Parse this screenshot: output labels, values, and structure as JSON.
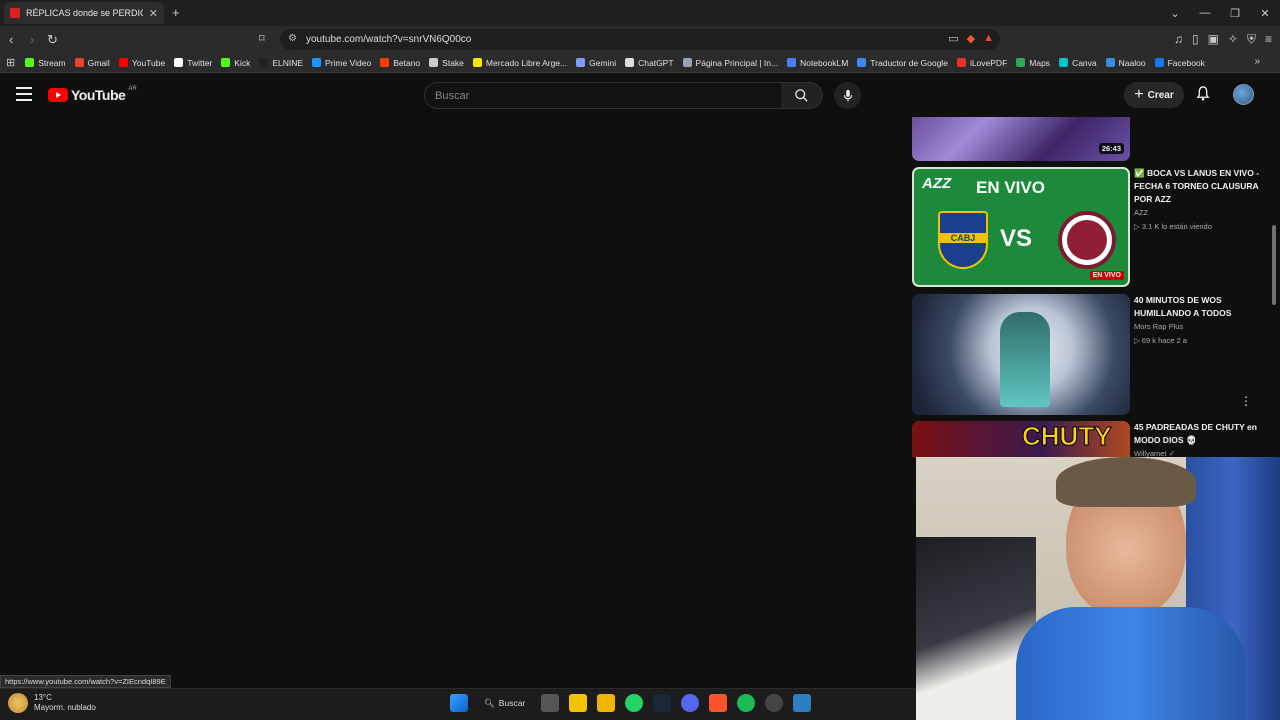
{
  "browser": {
    "tab_title": "RÉPLICAS donde se PERDIÓ TODO",
    "tab_close": "✕",
    "new_tab": "+",
    "url": "youtube.com/watch?v=snrVN6Q00co",
    "window_controls": [
      "⌄",
      "—",
      "❐",
      "✕"
    ],
    "bookmarks": [
      {
        "label": "Stream",
        "color": "#53fc18"
      },
      {
        "label": "Gmail",
        "color": "#ea4335"
      },
      {
        "label": "YouTube",
        "color": "#ff0000"
      },
      {
        "label": "Twitter",
        "color": "#ffffff"
      },
      {
        "label": "Kick",
        "color": "#53fc18"
      },
      {
        "label": "ELNINE",
        "color": "#222222"
      },
      {
        "label": "Prime Video",
        "color": "#1a98ff"
      },
      {
        "label": "Betano",
        "color": "#ff3c00"
      },
      {
        "label": "Stake",
        "color": "#cccccc"
      },
      {
        "label": "Mercado Libre Arge...",
        "color": "#ffe600"
      },
      {
        "label": "Gemini",
        "color": "#7a9cff"
      },
      {
        "label": "ChatGPT",
        "color": "#dddddd"
      },
      {
        "label": "Página Principal | In...",
        "color": "#9aa3b5"
      },
      {
        "label": "NotebookLM",
        "color": "#4b7bff"
      },
      {
        "label": "Traductor de Google",
        "color": "#4285f4"
      },
      {
        "label": "iLovePDF",
        "color": "#e5322d"
      },
      {
        "label": "Maps",
        "color": "#34a853"
      },
      {
        "label": "Canva",
        "color": "#00c4cc"
      },
      {
        "label": "Naaloo",
        "color": "#3a8dde"
      },
      {
        "label": "Facebook",
        "color": "#1877f2"
      }
    ],
    "bookmarks_more": "»",
    "status_url": "https://www.youtube.com/watch?v=ZIEcndqI89E"
  },
  "youtube": {
    "logo_text": "YouTube",
    "country_code": "AR",
    "search_placeholder": "Buscar",
    "create_label": "Crear",
    "recommendations": [
      {
        "title": "",
        "channel": "",
        "stats": "",
        "duration": "26:43"
      },
      {
        "title": "✅ BOCA VS LANUS EN VIVO - FECHA 6 TORNEO CLAUSURA POR AZZ",
        "channel": "AZZ",
        "stats": "▷ 3.1 K lo están viendo",
        "thumb_text": "EN VIVO",
        "thumb_brand": "AZZ",
        "thumb_vs": "VS",
        "thumb_team": "CABJ",
        "badge": "EN VIVO"
      },
      {
        "title": "40 MINUTOS DE WOS HUMILLANDO A TODOS",
        "channel": "Mors Rap Plus",
        "stats": "▷ 69 k  hace 2 a"
      },
      {
        "title": "45 PADREADAS DE CHUTY en MODO DIOS 💀",
        "channel": "Willyamet ✓",
        "thumb_text": "CHUTY"
      }
    ]
  },
  "taskbar": {
    "temperature": "13°C",
    "weather": "Mayorm. nublado",
    "search_label": "Buscar"
  }
}
